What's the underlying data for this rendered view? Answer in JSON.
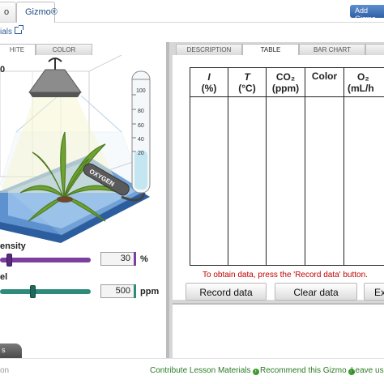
{
  "header": {
    "tabs": [
      {
        "label": "o"
      },
      {
        "label": "Gizmo®"
      }
    ],
    "add_button": "Add Gizmo",
    "sub_link": "ials"
  },
  "left_panel": {
    "tabs": [
      {
        "label": "HITE"
      },
      {
        "label": "COLOR"
      }
    ],
    "corner_label": "0",
    "tube": {
      "ticks": [
        "100",
        "80",
        "60",
        "40",
        "20"
      ],
      "label": "OXYGEN"
    },
    "light": {
      "label": "ensity",
      "value": "30",
      "unit": "%",
      "fraction": 0.11
    },
    "co2": {
      "label": "el",
      "value": "500",
      "unit": "ppm",
      "fraction": 0.4
    },
    "bottom_button": "s"
  },
  "right_panel": {
    "tabs": [
      {
        "label": "DESCRIPTION"
      },
      {
        "label": "TABLE"
      },
      {
        "label": "BAR CHART"
      },
      {
        "label": ""
      }
    ],
    "table": {
      "headers": [
        {
          "line1": "I",
          "line2": "(%)"
        },
        {
          "line1": "T",
          "line2": "(°C)"
        },
        {
          "line1": "CO₂",
          "line2": "(ppm)"
        },
        {
          "line1": "Color",
          "line2": ""
        },
        {
          "line1": "O₂",
          "line2": "(mL/h"
        }
      ]
    },
    "message": "To obtain data, press the 'Record data' button.",
    "buttons": {
      "record": "Record data",
      "clear": "Clear data",
      "export": "Ex"
    }
  },
  "footer": {
    "left": "on",
    "links": [
      {
        "label": "Contribute Lesson Materials"
      },
      {
        "label": "Recommend this Gizmo"
      },
      {
        "label": "Leave us"
      }
    ]
  },
  "colors": {
    "accent_blue": "#2f5fa4",
    "light_slider": "#7b3fa0",
    "co2_slider": "#2e8a7a",
    "message_red": "#c00000",
    "footer_green": "#2b7a24"
  }
}
